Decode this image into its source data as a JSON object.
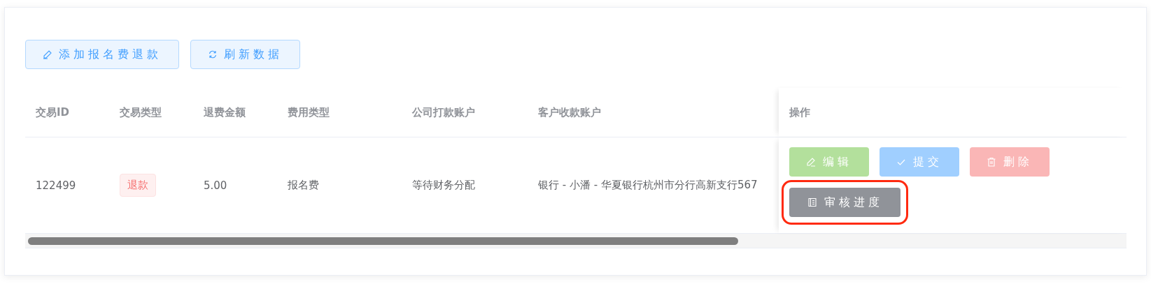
{
  "toolbar": [
    {
      "label": "添加报名费退款",
      "kind": "add"
    },
    {
      "label": "刷新数据",
      "kind": "refresh"
    }
  ],
  "table": {
    "columns": [
      "交易ID",
      "交易类型",
      "退费金额",
      "费用类型",
      "公司打款账户",
      "客户收款账户",
      "操作"
    ],
    "rows": [
      {
        "id": "122499",
        "type_tag": "退款",
        "amount": "5.00",
        "fee_type": "报名费",
        "company_account": "等待财务分配",
        "customer_account": "银行 - 小潘 - 华夏银行杭州市分行高新支行567",
        "actions": [
          {
            "label": "编辑",
            "kind": "edit",
            "highlighted": false
          },
          {
            "label": "提交",
            "kind": "submit",
            "highlighted": false
          },
          {
            "label": "删除",
            "kind": "delete",
            "highlighted": false
          },
          {
            "label": "审核进度",
            "kind": "progress",
            "highlighted": true
          }
        ]
      }
    ]
  }
}
